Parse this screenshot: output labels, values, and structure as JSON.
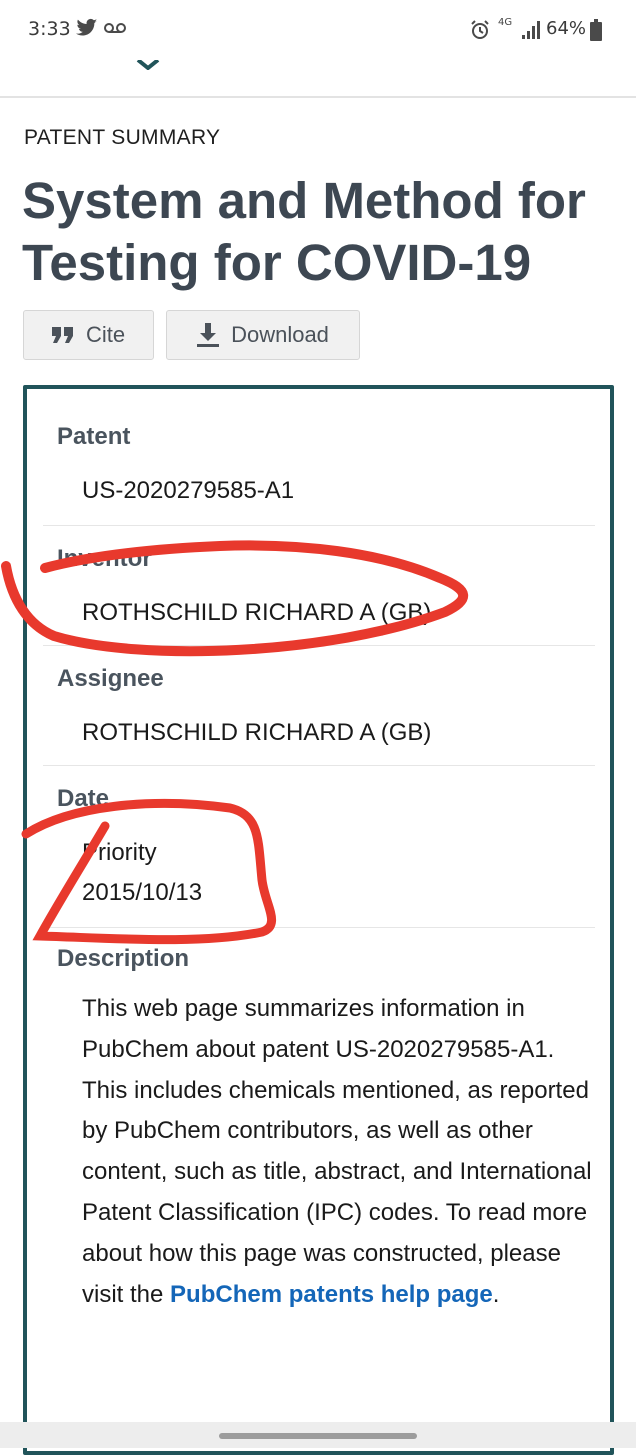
{
  "status_bar": {
    "time": "3:33",
    "network": "4G",
    "battery": "64%"
  },
  "page": {
    "kicker": "PATENT SUMMARY",
    "title": "System and Method for Testing for COVID-19"
  },
  "actions": {
    "cite_label": "Cite",
    "download_label": "Download"
  },
  "summary": {
    "patent_label": "Patent",
    "patent_value": "US-2020279585-A1",
    "inventor_label": "Inventor",
    "inventor_value": "ROTHSCHILD RICHARD A (GB)",
    "assignee_label": "Assignee",
    "assignee_value": "ROTHSCHILD RICHARD A (GB)",
    "date_label": "Date",
    "date_type": "Priority",
    "date_value": "2015/10/13",
    "description_label": "Description",
    "description_text": "This web page summarizes information in PubChem about patent US-2020279585-A1. This includes chemicals mentioned, as reported by PubChem contributors, as well as other content, such as title, abstract, and International Patent Classification (IPC) codes. To read more about how this page was constructed, please visit the",
    "help_link": "PubChem patents help page",
    "description_end": "."
  },
  "colors": {
    "card_border": "#21545a",
    "title": "#3d4752",
    "link": "#1466b8",
    "annotation": "#e8392d"
  },
  "icons": [
    "twitter-icon",
    "voicemail-icon",
    "alarm-icon",
    "signal-icon",
    "battery-icon",
    "quote-icon",
    "download-icon"
  ]
}
